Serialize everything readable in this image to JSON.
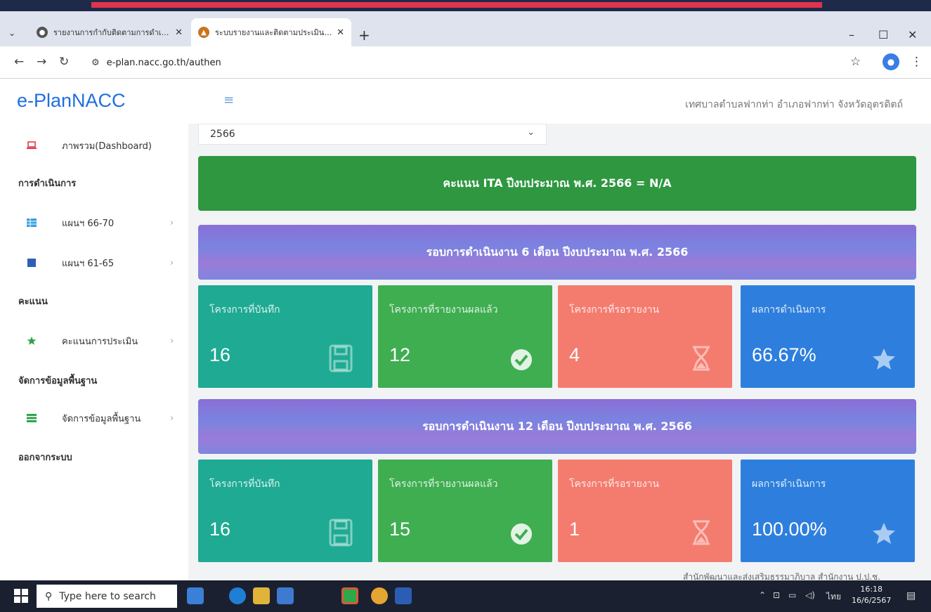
{
  "browser": {
    "tabs": [
      {
        "label": "รายงานการกำกับติดตามการดำเนิน"
      },
      {
        "label": "ระบบรายงานและติดตามประเมินผลการ"
      }
    ],
    "tab_close": "✕",
    "new_tab": "+",
    "url": "e-plan.nacc.go.th/authen",
    "window_controls": {
      "minimize": "–",
      "maximize": "☐",
      "close": "✕"
    }
  },
  "app": {
    "brand": "e-PlanNACC",
    "org_name": "เทศบาลตำบลฟากท่า อำเภอฟากท่า จังหวัดอุตรดิตถ์"
  },
  "sidebar": {
    "dashboard": "ภาพรวม(Dashboard)",
    "section_operation": "การดำเนินการ",
    "plan_66_70": "แผนฯ 66-70",
    "plan_61_65": "แผนฯ 61-65",
    "section_score": "คะแนน",
    "evaluation_score": "คะแนนการประเมิน",
    "section_master": "จัดการข้อมูลพื้นฐาน",
    "master_data": "จัดการข้อมูลพื้นฐาน",
    "logout": "ออกจากระบบ",
    "arrow": "›"
  },
  "main": {
    "year": "2566",
    "ita_banner": "คะแนน ITA ปีงบประมาณ พ.ศ. 2566 = N/A",
    "round1": {
      "title": "รอบการดำเนินงาน 6 เดือน ปีงบประมาณ พ.ศ. 2566",
      "cards": [
        {
          "label": "โครงการที่บันทึก",
          "value": "16"
        },
        {
          "label": "โครงการที่รายงานผลแล้ว",
          "value": "12"
        },
        {
          "label": "โครงการที่รอรายงาน",
          "value": "4"
        },
        {
          "label": "ผลการดำเนินการ",
          "value": "66.67%"
        }
      ]
    },
    "round2": {
      "title": "รอบการดำเนินงาน 12 เดือน ปีงบประมาณ พ.ศ. 2566",
      "cards": [
        {
          "label": "โครงการที่บันทึก",
          "value": "16"
        },
        {
          "label": "โครงการที่รายงานผลแล้ว",
          "value": "15"
        },
        {
          "label": "โครงการที่รอรายงาน",
          "value": "1"
        },
        {
          "label": "ผลการดำเนินการ",
          "value": "100.00%"
        }
      ]
    },
    "footnote": "สำนักพัฒนาและส่งเสริมธรรมาภิบาล สำนักงาน ป.ป.ช."
  },
  "taskbar": {
    "search_placeholder": "Type here to search",
    "language": "ไทย",
    "time": "16:18",
    "date": "16/6/2567"
  },
  "colors": {
    "ita_green": "#2e9740",
    "teal": "#1eaa93",
    "green": "#3fae51",
    "salmon": "#f47c6f",
    "blue": "#2e7fdd",
    "brand_blue": "#1f6fe0"
  }
}
